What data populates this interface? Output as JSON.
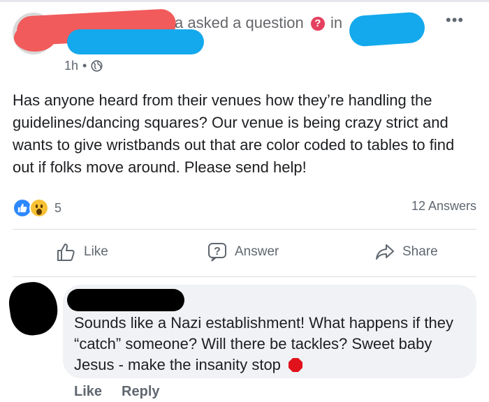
{
  "header": {
    "asked_prefix": "a asked a question",
    "question_icon": "question-mark-icon",
    "in_word": "in",
    "question_glyph": "?",
    "more_glyph": "•••",
    "time": "1h",
    "separator": "•",
    "privacy_icon": "globe-icon"
  },
  "post": {
    "text": "Has anyone heard from their venues how they’re handling the guidelines/dancing squares? Our venue is being crazy strict and wants to give wristbands out that are color coded to tables to find out if folks move around. Please send help!"
  },
  "stats": {
    "reaction_count": "5",
    "answers": "12 Answers",
    "reactions": [
      "like",
      "wow"
    ]
  },
  "actions": {
    "like": "Like",
    "answer": "Answer",
    "answer_glyph": "?",
    "share": "Share"
  },
  "comment": {
    "text": "Sounds like a Nazi establishment! What happens if they “catch” someone? Will there be tackles? Sweet baby Jesus - make the insanity stop",
    "like": "Like",
    "reply": "Reply"
  },
  "colors": {
    "redaction_red": "#f15b5b",
    "redaction_blue": "#14a9ec",
    "accent_blue": "#2d88ff",
    "question_badge": "#e4405f",
    "stop_red": "#e0121b"
  }
}
